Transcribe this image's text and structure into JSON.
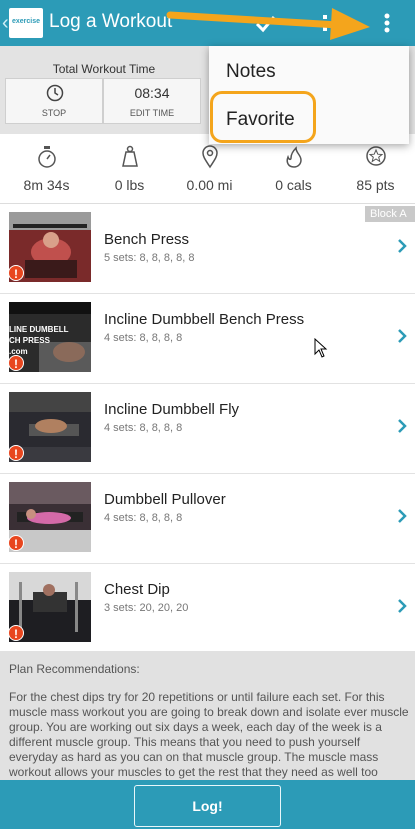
{
  "app_bar": {
    "logo_text": "exercise",
    "title": "Log a Workout"
  },
  "timer": {
    "title": "Total Workout Time",
    "stop_label": "STOP",
    "time_value": "08:34",
    "edit_label": "EDIT TIME"
  },
  "menu": {
    "items": [
      {
        "label": "Notes"
      },
      {
        "label": "Favorite"
      }
    ]
  },
  "stats": [
    {
      "icon": "stopwatch-icon",
      "value": "8m 34s"
    },
    {
      "icon": "weight-icon",
      "value": "0 lbs"
    },
    {
      "icon": "location-pin-icon",
      "value": "0.00 mi"
    },
    {
      "icon": "flame-icon",
      "value": "0 cals"
    },
    {
      "icon": "star-icon",
      "value": "85 pts"
    }
  ],
  "block_label": "Block A",
  "exercises": [
    {
      "name": "Bench Press",
      "sets": "5 sets: 8, 8, 8, 8, 8"
    },
    {
      "name": "Incline Dumbbell Bench Press",
      "sets": "4 sets: 8, 8, 8, 8",
      "thumb_text": "LINE DUMBELL\nCH PRESS\n.com"
    },
    {
      "name": "Incline Dumbbell Fly",
      "sets": "4 sets: 8, 8, 8, 8"
    },
    {
      "name": "Dumbbell Pullover",
      "sets": "4 sets: 8, 8, 8, 8"
    },
    {
      "name": "Chest Dip",
      "sets": "3 sets: 20, 20, 20"
    }
  ],
  "recommendations": {
    "title": "Plan Recommendations:",
    "body": "For the chest dips try for 20 repetitions or until failure each set. For this muscle mass workout you are going to break down and isolate ever muscle group. You are working out six days a week, each day of the week is a different muscle group. This means that you need to push yourself everyday as hard as you can on that muscle group. The muscle mass workout allows your muscles to get the rest that they need as well too because each muscle group is only worked once a week and this gives you ample time to recover."
  },
  "footer": {
    "log_label": "Log!"
  },
  "colors": {
    "primary": "#2c9bb7",
    "highlight": "#f4a51c",
    "warning": "#e8461e"
  }
}
